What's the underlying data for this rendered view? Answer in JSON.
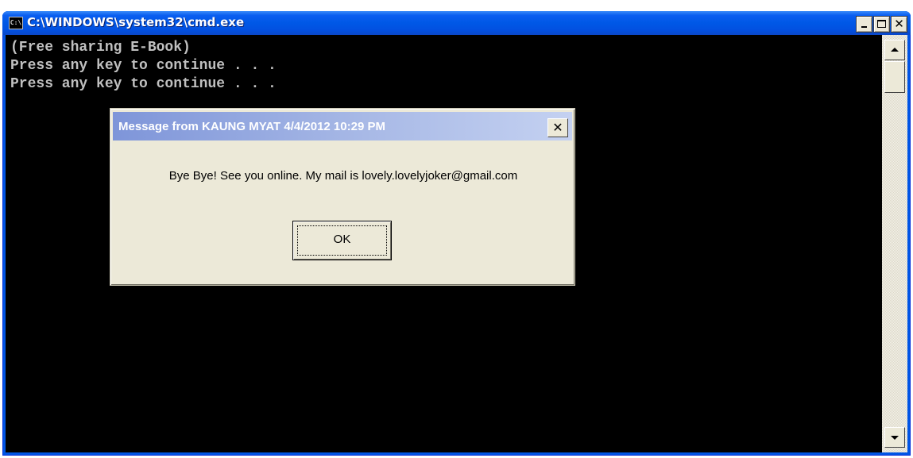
{
  "window": {
    "title": "C:\\WINDOWS\\system32\\cmd.exe",
    "icon": "cmd-icon",
    "icon_text": "C:\\",
    "controls": {
      "minimize": "minimize-icon",
      "maximize": "maximize-icon",
      "close": "close-icon",
      "close_glyph": "✕"
    }
  },
  "console": {
    "lines": [
      "(Free sharing E-Book)",
      "Press any key to continue . . .",
      "Press any key to continue . . ."
    ]
  },
  "scrollbar": {
    "up": "scroll-up-icon",
    "down": "scroll-down-icon"
  },
  "dialog": {
    "title": "Message from KAUNG MYAT 4/4/2012 10:29 PM",
    "close_glyph": "✕",
    "message": "Bye Bye! See you online. My mail is lovely.lovelyjoker@gmail.com",
    "ok_label": "OK"
  }
}
